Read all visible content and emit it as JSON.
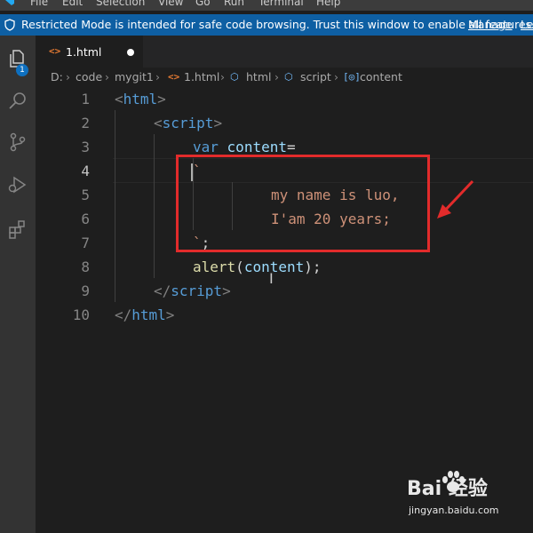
{
  "menu": {
    "items": [
      "File",
      "Edit",
      "Selection",
      "View",
      "Go",
      "Run",
      "Terminal",
      "Help"
    ]
  },
  "banner": {
    "message": "Restricted Mode is intended for safe code browsing. Trust this window to enable all features.",
    "manage": "Manage",
    "learn": "Le"
  },
  "activity": {
    "explorer_badge": "1"
  },
  "tab": {
    "icon": "<>",
    "name": "1.html"
  },
  "breadcrumb": {
    "drive": "D:",
    "folder1": "code",
    "folder2": "mygit1",
    "file": "1.html",
    "el1": "html",
    "el2": "script",
    "el3": "content"
  },
  "editor": {
    "line_numbers": [
      "1",
      "2",
      "3",
      "4",
      "5",
      "6",
      "7",
      "8",
      "9",
      "10"
    ],
    "active_line": "4",
    "lines": {
      "l1_open": "<",
      "l1_tag": "html",
      "l1_close": ">",
      "l2_open": "<",
      "l2_tag": "script",
      "l2_close": ">",
      "l3_kw": "var",
      "l3_var": "content",
      "l3_op": "=",
      "l4": "`",
      "l5": "my name is luo,",
      "l6": "I'am 20 years;",
      "l7_tick": "`",
      "l7_semi": ";",
      "l8_fn": "alert",
      "l8_open": "(",
      "l8_var": "content",
      "l8_close": ");",
      "l9_open": "</",
      "l9_tag": "script",
      "l9_close": ">",
      "l10_open": "</",
      "l10_tag": "html",
      "l10_close": ">"
    }
  },
  "colors": {
    "banner": "#0e5fa3",
    "annotation": "#e22b2b",
    "string": "#ce9178",
    "tag": "#569cd6"
  },
  "watermark": {
    "brand": "Bai  经验",
    "url": "jingyan.baidu.com"
  }
}
